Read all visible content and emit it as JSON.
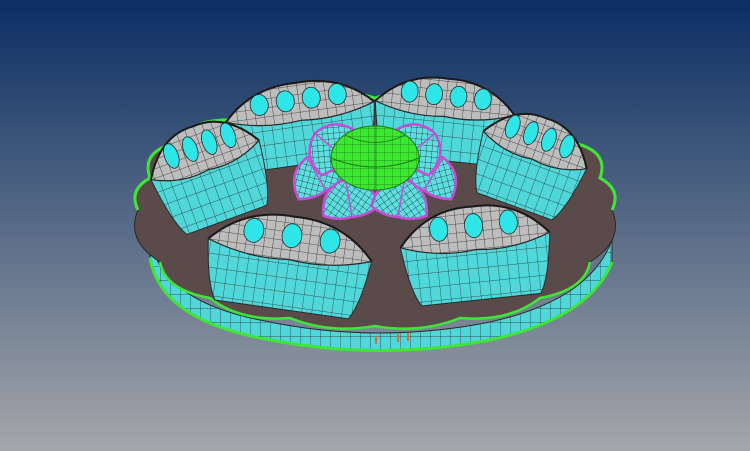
{
  "viewport": {
    "background": {
      "top_color": "#0b2e63",
      "bottom_color": "#a4a7aa"
    },
    "model": {
      "base_slab_color": "#5b4a4a",
      "ring_shell_gray": "#a9a9a9",
      "ring_shell_light": "#d9d9d9",
      "panel_cyan": "#2ee6e8",
      "wall_cyan": "#4fd7d9",
      "mesh_line_color": "#2a2a2a",
      "edge_green": "#3ee637",
      "dome_green": "#39e82f",
      "dome_rib_magenta": "#c64bd7",
      "seam_orange": "#e06a2b",
      "petal_count": 6,
      "inner_lobe_count": 6
    }
  }
}
